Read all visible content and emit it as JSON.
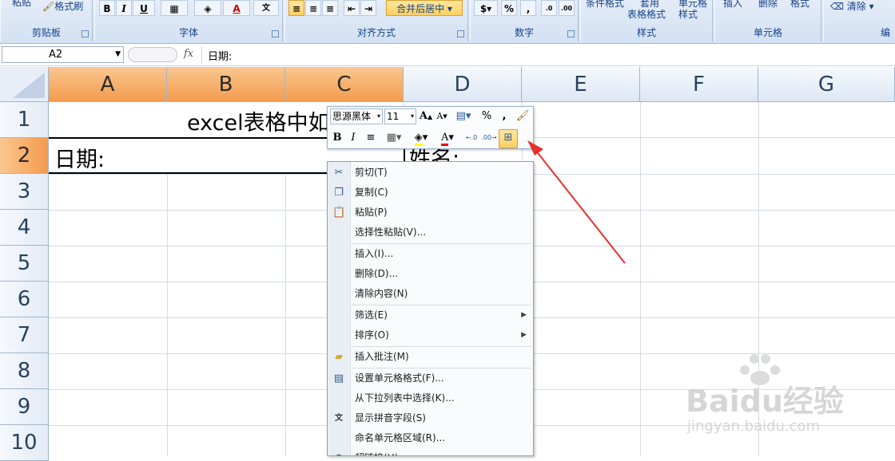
{
  "ribbon": {
    "groups": [
      {
        "label": "剪贴板"
      },
      {
        "label": "字体"
      },
      {
        "label": "对齐方式"
      },
      {
        "label": "数字"
      },
      {
        "label": "样式"
      },
      {
        "label": "单元格"
      },
      {
        "label": "编"
      }
    ],
    "paste_label": "粘贴",
    "format_painter_label": "格式刷",
    "bold": "B",
    "italic": "I",
    "underline": "U",
    "merge_center_label": "合并后居中",
    "percent": "%",
    "comma": ",",
    "cond_format_label": "条件格式",
    "table_format_line1": "套用",
    "table_format_line2": "表格格式",
    "cell_style_line1": "单元格",
    "cell_style_line2": "样式",
    "insert_label": "插入",
    "delete_label": "删除",
    "format_label": "格式",
    "clear_label": "清除"
  },
  "formula_bar": {
    "name_box": "A2",
    "fx": "fx",
    "content": "日期:"
  },
  "grid": {
    "columns": [
      "A",
      "B",
      "C",
      "D",
      "E",
      "F",
      "G"
    ],
    "rows": [
      "1",
      "2",
      "3",
      "4",
      "5",
      "6",
      "7",
      "8",
      "9",
      "10"
    ],
    "cell_A1_title": "excel表格中如",
    "cell_A2": "日期:",
    "cell_D2": "姓名:"
  },
  "mini_toolbar": {
    "font": "思源黑体",
    "size": "11",
    "bold": "B",
    "italic": "I",
    "percent": "%",
    "comma": ","
  },
  "context_menu": {
    "items": [
      {
        "label": "剪切(T)",
        "icon": "scissors-icon"
      },
      {
        "label": "复制(C)",
        "icon": "copy-icon"
      },
      {
        "label": "粘贴(P)",
        "icon": "paste-icon"
      },
      {
        "label": "选择性粘贴(V)..."
      },
      {
        "label": "插入(I)..."
      },
      {
        "label": "删除(D)..."
      },
      {
        "label": "清除内容(N)"
      },
      {
        "label": "筛选(E)",
        "submenu": true
      },
      {
        "label": "排序(O)",
        "submenu": true
      },
      {
        "label": "插入批注(M)",
        "icon": "comment-icon"
      },
      {
        "label": "设置单元格格式(F)...",
        "icon": "format-cells-icon"
      },
      {
        "label": "从下拉列表中选择(K)..."
      },
      {
        "label": "显示拼音字段(S)",
        "icon": "phonetic-icon"
      },
      {
        "label": "命名单元格区域(R)..."
      },
      {
        "label": "超链接(H)...",
        "icon": "hyperlink-icon"
      }
    ]
  },
  "watermark": {
    "logo": "Baidu经验",
    "url": "jingyan.baidu.com"
  },
  "colors": {
    "selected_header": "#f39b4d",
    "annotation_arrow": "#e8302b",
    "ribbon_text": "#15428b"
  }
}
